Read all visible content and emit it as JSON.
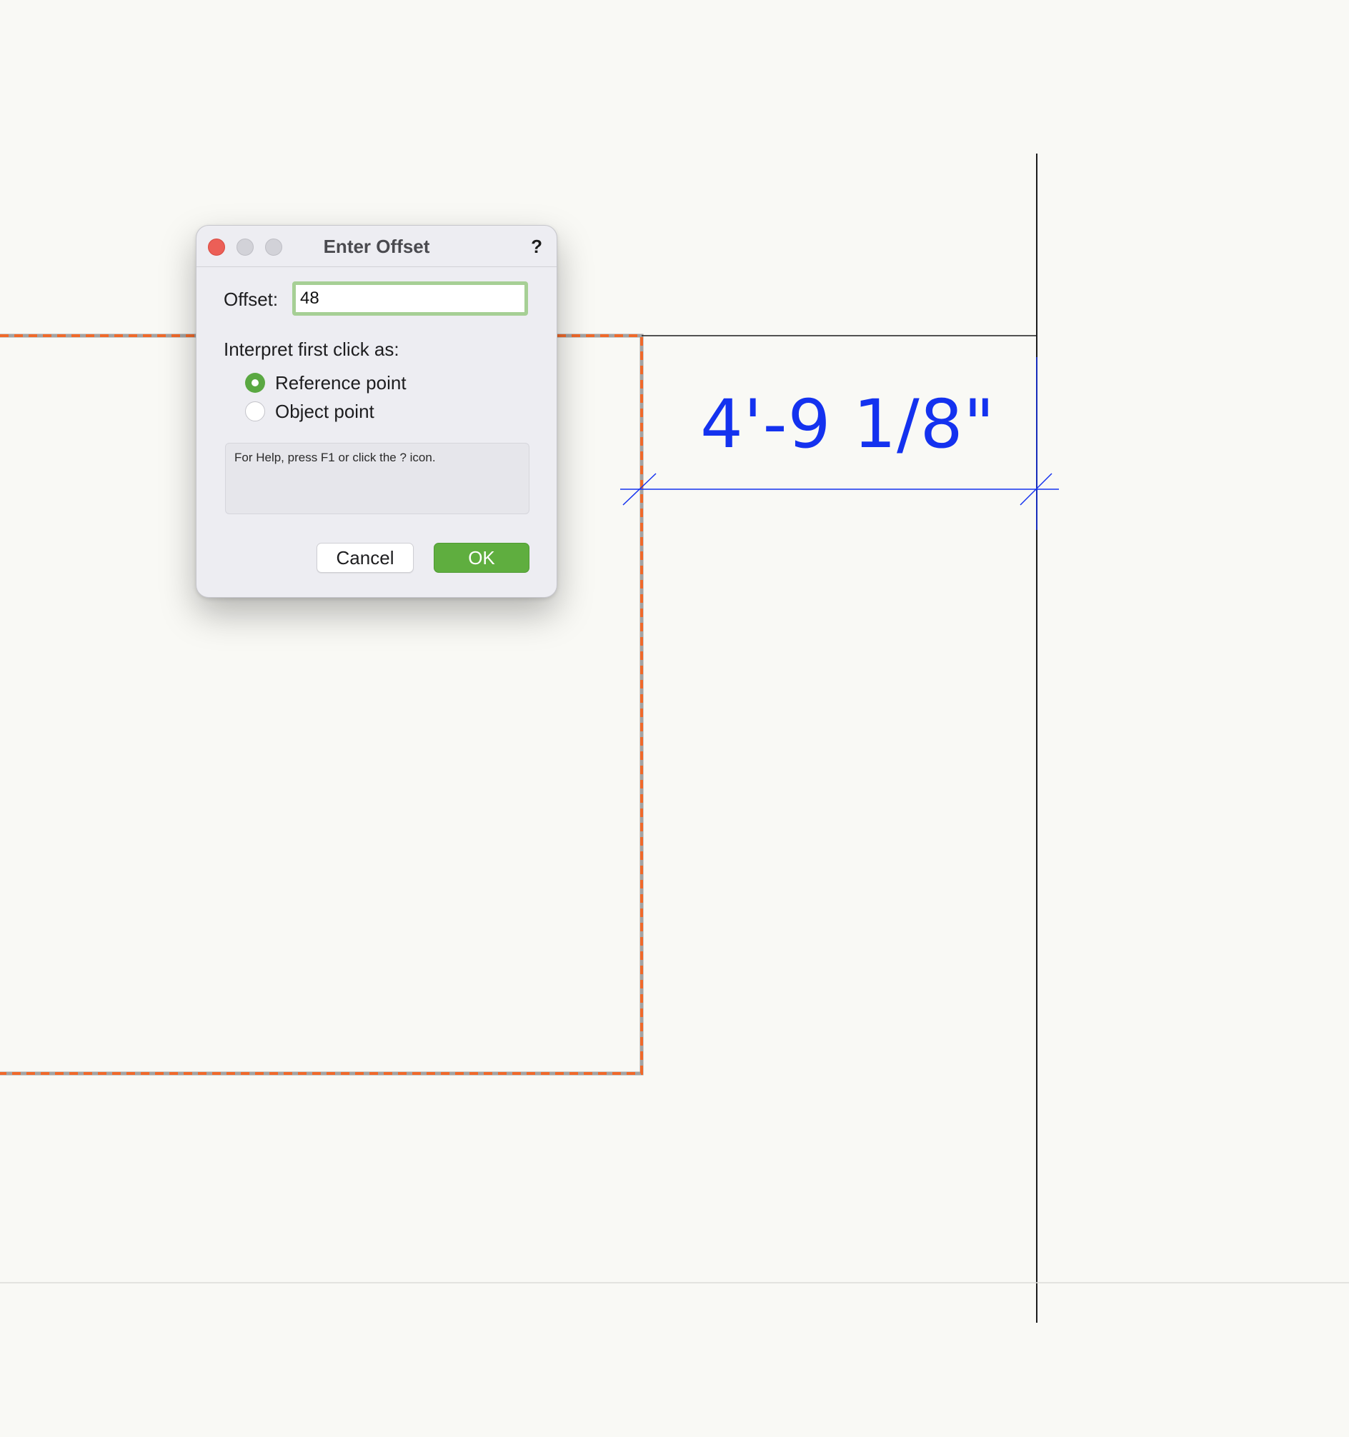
{
  "drawing": {
    "dimension_text": "4'-9 1/8\"",
    "colors": {
      "background": "#f9f9f5",
      "selection_outline": "#f0692a",
      "dimension": "#1432ef",
      "lines": "#1c1c1c"
    }
  },
  "dialog": {
    "title": "Enter Offset",
    "help_icon_text": "?",
    "window_controls": [
      "close-icon",
      "minimize-icon",
      "zoom-icon"
    ],
    "offset_label": "Offset:",
    "offset_value": "48",
    "interpret_label": "Interpret first click as:",
    "options": [
      {
        "label": "Reference point",
        "selected": true
      },
      {
        "label": "Object point",
        "selected": false
      }
    ],
    "help_text": "For Help, press F1 or click the ? icon.",
    "cancel_label": "Cancel",
    "ok_label": "OK",
    "accent_color": "#5fae3f"
  }
}
